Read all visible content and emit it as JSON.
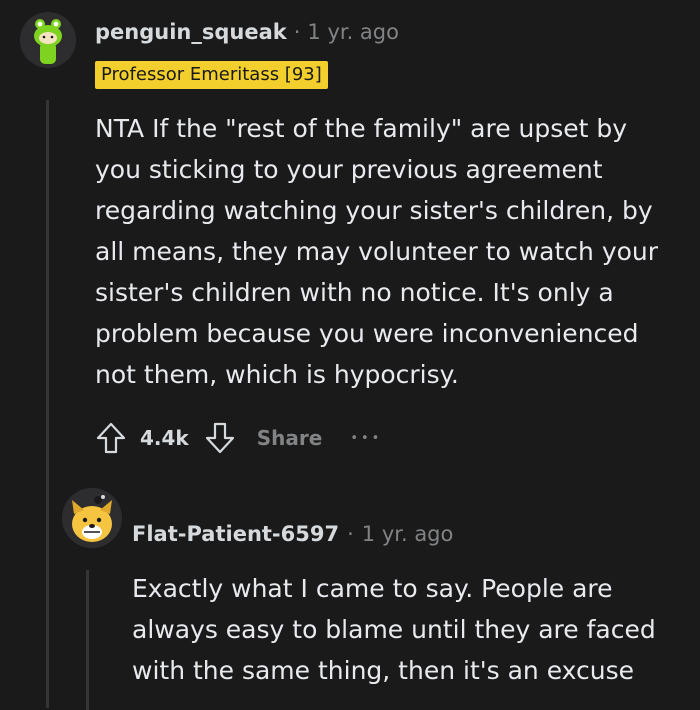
{
  "comments": [
    {
      "username": "penguin_squeak",
      "separator": "·",
      "time": "1 yr. ago",
      "flair": "Professor Emeritass [93]",
      "text": "NTA If the \"rest of the family\" are upset by you sticking to your previous agreement regarding watching your sister's children, by all means, they may volunteer to watch your sister's children with no notice. It's only a problem because you were inconvenienced not them, which is hypocrisy.",
      "lines": [
        "NTA If the \"rest of the family\" are upset by",
        "you sticking to your previous agreement",
        "regarding watching your sister's children, by",
        "all means, they may volunteer to watch your",
        "sister's children with no notice. It's only a",
        "problem because you were inconvenienced",
        "not them, which is hypocrisy."
      ],
      "score": "4.4k",
      "share_label": "Share",
      "more_label": "•••",
      "avatar_icon": "green-frog-avatar-icon"
    },
    {
      "username": "Flat-Patient-6597",
      "separator": "·",
      "time": "1 yr. ago",
      "lines": [
        "Exactly what I came to say. People are",
        "always easy to blame until they are faced",
        "with the same thing, then it's an excuse"
      ],
      "avatar_icon": "yellow-dog-avatar-icon"
    }
  ],
  "colors": {
    "background": "#1a1a1b",
    "flair": "#f2cf2c",
    "muted": "#818384",
    "thread_line": "#343536"
  }
}
